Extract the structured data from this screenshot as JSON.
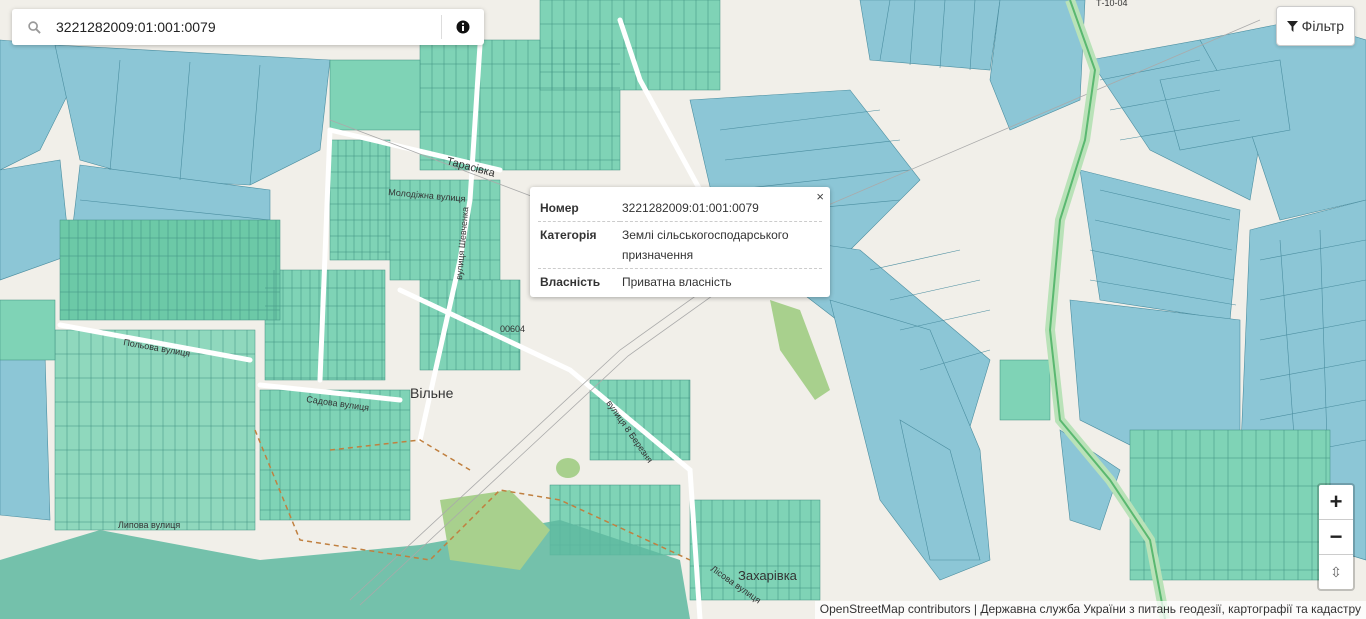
{
  "search": {
    "value": "3221282009:01:001:0079"
  },
  "filter": {
    "label": "Фільтр"
  },
  "popup": {
    "rows": [
      {
        "key": "Номер",
        "value": "3221282009:01:001:0079"
      },
      {
        "key": "Категорія",
        "value": "Землі сільськогосподарського призначення"
      },
      {
        "key": "Власність",
        "value": "Приватна власність"
      }
    ],
    "close": "×"
  },
  "zoom": {
    "in": "+",
    "out": "−",
    "reset": "⇳"
  },
  "attribution": {
    "link": "OpenStreetMap contributors",
    "text": " | Державна служба України з питань геодезії, картографії та кадастру"
  },
  "map_labels": {
    "village_1": "Вільне",
    "village_2": "Захарівка",
    "locality_1": "Тарасівка",
    "street_1": "Молодіжна вулиця",
    "street_2": "вулиця Шевченка",
    "street_3": "Садова вулиця",
    "street_4": "вулиця 8 Березня",
    "street_5": "Лісова вулиця",
    "street_6": "Польова вулиця",
    "street_7": "Липова вулиця",
    "road_code": "00604",
    "road_code_2": "Т-10-04"
  },
  "colors": {
    "parcel": "#8cc6d6",
    "parcel_small": "#7fd3b6",
    "parcel_dark": "#4fb2a5",
    "forest": "#a8d08d",
    "road": "#ffffff",
    "highway": "#8fd19a"
  }
}
